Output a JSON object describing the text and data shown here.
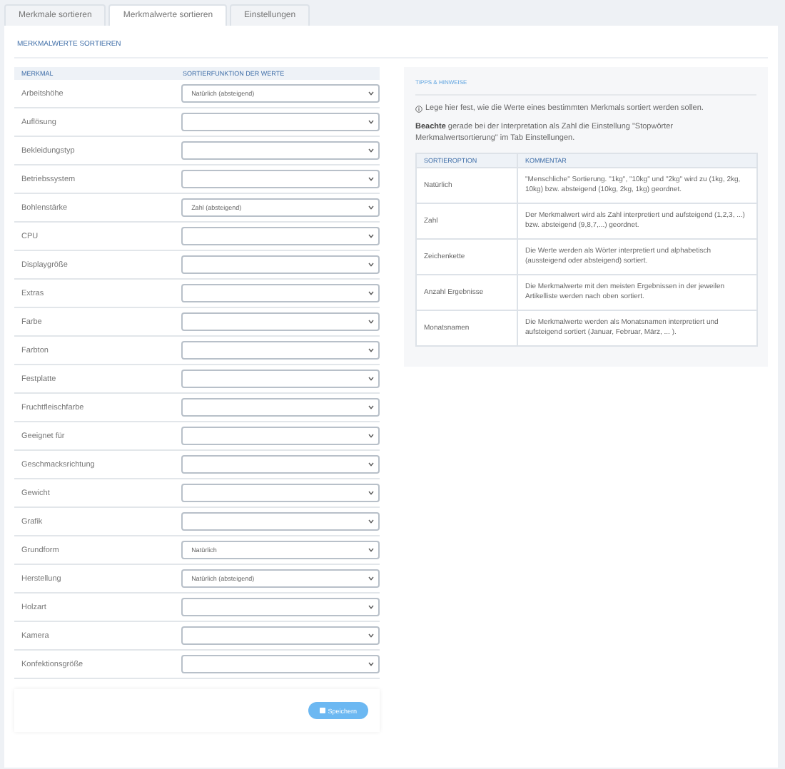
{
  "tabs": [
    {
      "label": "Merkmale sortieren",
      "selected": false
    },
    {
      "label": "Merkmalwerte sortieren",
      "selected": true
    },
    {
      "label": "Einstellungen",
      "selected": false
    }
  ],
  "section_title": "MERKMALWERTE SORTIEREN",
  "table": {
    "columns": [
      "MERKMAL",
      "SORTIERFUNKTION DER WERTE"
    ],
    "rows": [
      {
        "name": "Arbeitshöhe",
        "value": "Natürlich (absteigend)"
      },
      {
        "name": "Auflösung"
      },
      {
        "name": "Bekleidungstyp"
      },
      {
        "name": "Betriebssystem"
      },
      {
        "name": "Bohlenstärke",
        "value": "Zahl (absteigend)"
      },
      {
        "name": "CPU"
      },
      {
        "name": "Displaygröße"
      },
      {
        "name": "Extras"
      },
      {
        "name": "Farbe"
      },
      {
        "name": "Farbton"
      },
      {
        "name": "Festplatte"
      },
      {
        "name": "Fruchtfleischfarbe"
      },
      {
        "name": "Geeignet für"
      },
      {
        "name": "Geschmacksrichtung"
      },
      {
        "name": "Gewicht"
      },
      {
        "name": "Grafik"
      },
      {
        "name": "Grundform",
        "value": "Natürlich"
      },
      {
        "name": "Herstellung",
        "value": "Natürlich (absteigend)"
      },
      {
        "name": "Holzart"
      },
      {
        "name": "Kamera"
      },
      {
        "name": "Konfektionsgröße"
      }
    ]
  },
  "save_button": "Speichern",
  "tips": {
    "title": "TIPPS & HINWEISE",
    "info": "Lege hier fest, wie die Werte eines bestimmten Merkmals sortiert werden sollen.",
    "note": "**Beachte** gerade bei der Interpretation als Zahl die Einstellung \"Stopwörter Merkmalwertsortierung\" im Tab Einstellungen.",
    "columns": [
      "SORTIEROPTION",
      "KOMMENTAR"
    ],
    "rows": [
      {
        "option": "Natürlich",
        "comment": "\"Menschliche\" Sortierung. \"1kg\", \"10kg\" und \"2kg\" wird zu (1kg, 2kg, 10kg) bzw. absteigend (10kg, 2kg, 1kg) geordnet."
      },
      {
        "option": "Zahl",
        "comment": "Der Merkmalwert wird als Zahl interpretiert und aufsteigend (1,2,3, ...) bzw. absteigend (9,8,7,...) geordnet."
      },
      {
        "option": "Zeichenkette",
        "comment": "Die Werte werden als Wörter interpretiert und alphabetisch (aussteigend oder absteigend) sortiert."
      },
      {
        "option": "Anzahl Ergebnisse",
        "comment": "Die Merkmalwerte mit den meisten Ergebnissen in der jeweilen Artikelliste werden nach oben sortiert."
      },
      {
        "option": "Monatsnamen",
        "comment": "Die Merkmalwerte werden als Monatsnamen interpretiert und aufsteigend sortiert (Januar, Februar, März, ... )."
      }
    ]
  }
}
